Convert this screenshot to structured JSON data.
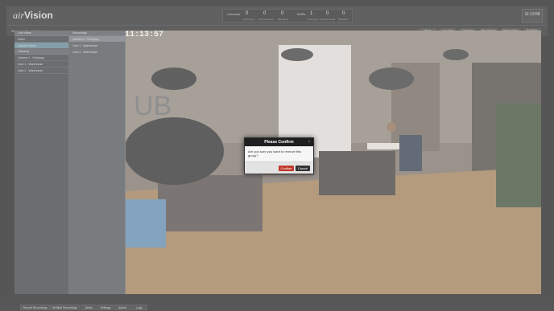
{
  "app": {
    "logo_prefix": "air",
    "logo_main": "Vision"
  },
  "stats": [
    {
      "label": "Cameras",
      "value": "0",
      "sub": "Connected"
    },
    {
      "label": "",
      "value": "0",
      "sub": "Disconnected"
    },
    {
      "label": "",
      "value": "0",
      "sub": "Managed"
    },
    {
      "label": "NVRs",
      "value": "1",
      "sub": "Connected"
    },
    {
      "label": "",
      "value": "0",
      "sub": "Disconnected"
    },
    {
      "label": "",
      "value": "0",
      "sub": "Managed"
    }
  ],
  "clock": {
    "time": "11:13:58",
    "date": ""
  },
  "view": {
    "title": "Welcome Frank Watt"
  },
  "toolbar": [
    "Views",
    "Live View",
    "Cameras",
    "Recordings",
    "Reset Views",
    "NVR/Rec"
  ],
  "sidebar1": {
    "head1": "Live Views",
    "row1": "Video",
    "row2": "Camera Name",
    "head2": "Cameras",
    "rows": [
      "Camera 1 - Entryway",
      "Cam 1 - Warehouse",
      "Cam 2 - Warehouse"
    ]
  },
  "sidebar2": {
    "head": "Recordings",
    "rows": [
      "Camera 1 - Entryway",
      "Cam 1 - Warehouse",
      "Cam 2 - Warehouse"
    ]
  },
  "camera": {
    "timestamp": "11:13:57"
  },
  "dialog": {
    "title": "Please Confirm",
    "message": "Are you sure you want to remove this group?",
    "confirm": "Confirm",
    "cancel": "Cancel",
    "close_icon": "×"
  },
  "bottom_tabs": [
    "Record Recordings",
    "Multiple Recordings",
    "Alerts",
    "Settings",
    "Admin",
    "Logs"
  ]
}
